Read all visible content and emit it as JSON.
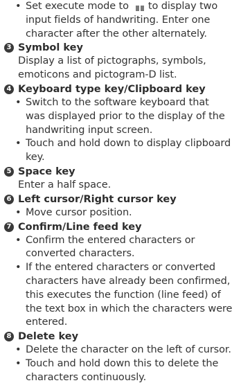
{
  "intro": {
    "bullet": "•",
    "line1_before_icon": "Set execute mode to",
    "line1_after_icon": "to display two",
    "line2": "input fields of handwriting. Enter one",
    "line3": "character after the other alternately.",
    "mode_icon": "dual-input-mode-icon"
  },
  "sections": [
    {
      "number": "3",
      "title": "Symbol key",
      "text": [
        "Display a list of pictographs, symbols,",
        "emoticons and pictogram-D list."
      ]
    },
    {
      "number": "4",
      "title": "Keyboard type key/Clipboard key",
      "bullets": [
        [
          "Switch to the software keyboard that",
          "was displayed prior to the display of the",
          "handwriting input screen."
        ],
        [
          "Touch and hold down to display clipboard",
          "key."
        ]
      ]
    },
    {
      "number": "5",
      "title": "Space key",
      "text": [
        "Enter a half space."
      ]
    },
    {
      "number": "6",
      "title": "Left cursor/Right cursor key",
      "bullets": [
        [
          "Move cursor position."
        ]
      ]
    },
    {
      "number": "7",
      "title": "Confirm/Line feed key",
      "bullets": [
        [
          "Confirm the entered characters or",
          "converted characters."
        ],
        [
          "If the entered characters or converted",
          "characters have already been confirmed,",
          "this executes the function (line feed) of",
          "the text box in which the characters were",
          "entered."
        ]
      ]
    },
    {
      "number": "8",
      "title": "Delete key",
      "bullets": [
        [
          "Delete the character on the left of cursor."
        ],
        [
          "Touch and hold down this to delete the",
          "characters continuously."
        ]
      ]
    }
  ]
}
